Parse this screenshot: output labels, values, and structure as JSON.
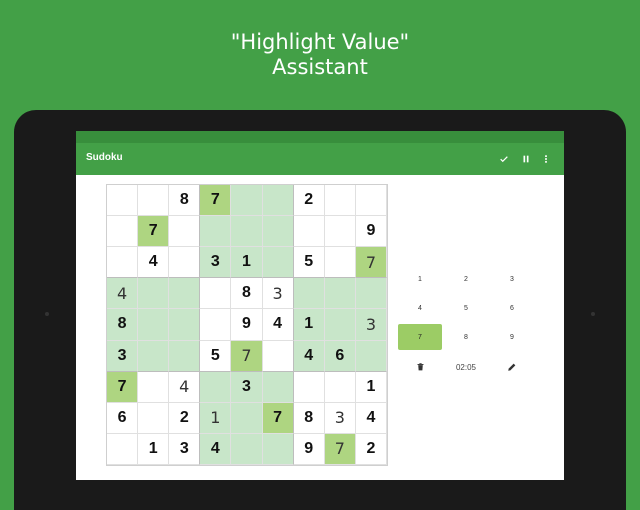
{
  "promo": {
    "line1": "\"Highlight Value\"",
    "line2": "Assistant"
  },
  "app": {
    "title": "Sudoku",
    "icons": [
      "check-icon",
      "pause-icon",
      "more-vert-icon"
    ]
  },
  "colors": {
    "background": "#43a047",
    "statusbar": "#388e3c",
    "highlight": "#c8e6c9",
    "selected": "#aed581",
    "key_active": "#9ccc65"
  },
  "grid": [
    [
      {
        "v": "",
        "t": "",
        "h": 0
      },
      {
        "v": "",
        "t": "",
        "h": 0
      },
      {
        "v": "8",
        "t": "g",
        "h": 0
      },
      {
        "v": "7",
        "t": "g",
        "h": 2
      },
      {
        "v": "",
        "t": "",
        "h": 1
      },
      {
        "v": "",
        "t": "",
        "h": 1
      },
      {
        "v": "2",
        "t": "g",
        "h": 0
      },
      {
        "v": "",
        "t": "",
        "h": 0
      },
      {
        "v": "",
        "t": "",
        "h": 0
      }
    ],
    [
      {
        "v": "",
        "t": "",
        "h": 0
      },
      {
        "v": "7",
        "t": "g",
        "h": 2
      },
      {
        "v": "",
        "t": "",
        "h": 0
      },
      {
        "v": "",
        "t": "",
        "h": 1
      },
      {
        "v": "",
        "t": "",
        "h": 1
      },
      {
        "v": "",
        "t": "",
        "h": 1
      },
      {
        "v": "",
        "t": "",
        "h": 0
      },
      {
        "v": "",
        "t": "",
        "h": 0
      },
      {
        "v": "9",
        "t": "g",
        "h": 0
      }
    ],
    [
      {
        "v": "",
        "t": "",
        "h": 0
      },
      {
        "v": "4",
        "t": "g",
        "h": 0
      },
      {
        "v": "",
        "t": "",
        "h": 0
      },
      {
        "v": "3",
        "t": "g",
        "h": 1
      },
      {
        "v": "1",
        "t": "g",
        "h": 1
      },
      {
        "v": "",
        "t": "",
        "h": 1
      },
      {
        "v": "5",
        "t": "g",
        "h": 0
      },
      {
        "v": "",
        "t": "",
        "h": 0
      },
      {
        "v": "7",
        "t": "e",
        "h": 2
      }
    ],
    [
      {
        "v": "4",
        "t": "e",
        "h": 1
      },
      {
        "v": "",
        "t": "",
        "h": 1
      },
      {
        "v": "",
        "t": "",
        "h": 1
      },
      {
        "v": "",
        "t": "",
        "h": 0
      },
      {
        "v": "8",
        "t": "g",
        "h": 0
      },
      {
        "v": "3",
        "t": "e",
        "h": 0
      },
      {
        "v": "",
        "t": "",
        "h": 1
      },
      {
        "v": "",
        "t": "",
        "h": 1
      },
      {
        "v": "",
        "t": "",
        "h": 1
      }
    ],
    [
      {
        "v": "8",
        "t": "g",
        "h": 1
      },
      {
        "v": "",
        "t": "",
        "h": 1
      },
      {
        "v": "",
        "t": "",
        "h": 1
      },
      {
        "v": "",
        "t": "",
        "h": 0
      },
      {
        "v": "9",
        "t": "g",
        "h": 0
      },
      {
        "v": "4",
        "t": "g",
        "h": 0
      },
      {
        "v": "1",
        "t": "g",
        "h": 1
      },
      {
        "v": "",
        "t": "",
        "h": 1
      },
      {
        "v": "3",
        "t": "e",
        "h": 1
      }
    ],
    [
      {
        "v": "3",
        "t": "g",
        "h": 1
      },
      {
        "v": "",
        "t": "",
        "h": 1
      },
      {
        "v": "",
        "t": "",
        "h": 1
      },
      {
        "v": "5",
        "t": "g",
        "h": 0
      },
      {
        "v": "7",
        "t": "e",
        "h": 2
      },
      {
        "v": "",
        "t": "",
        "h": 0
      },
      {
        "v": "4",
        "t": "g",
        "h": 1
      },
      {
        "v": "6",
        "t": "g",
        "h": 1
      },
      {
        "v": "",
        "t": "",
        "h": 1
      }
    ],
    [
      {
        "v": "7",
        "t": "g",
        "h": 2
      },
      {
        "v": "",
        "t": "",
        "h": 0
      },
      {
        "v": "4",
        "t": "e",
        "h": 0
      },
      {
        "v": "",
        "t": "",
        "h": 1
      },
      {
        "v": "3",
        "t": "g",
        "h": 1
      },
      {
        "v": "",
        "t": "",
        "h": 1
      },
      {
        "v": "",
        "t": "",
        "h": 0
      },
      {
        "v": "",
        "t": "",
        "h": 0
      },
      {
        "v": "1",
        "t": "g",
        "h": 0
      }
    ],
    [
      {
        "v": "6",
        "t": "g",
        "h": 0
      },
      {
        "v": "",
        "t": "",
        "h": 0
      },
      {
        "v": "2",
        "t": "g",
        "h": 0
      },
      {
        "v": "1",
        "t": "e",
        "h": 1
      },
      {
        "v": "",
        "t": "",
        "h": 1
      },
      {
        "v": "7",
        "t": "g",
        "h": 2
      },
      {
        "v": "8",
        "t": "g",
        "h": 0
      },
      {
        "v": "3",
        "t": "e",
        "h": 0
      },
      {
        "v": "4",
        "t": "g",
        "h": 0
      }
    ],
    [
      {
        "v": "",
        "t": "",
        "h": 0
      },
      {
        "v": "1",
        "t": "g",
        "h": 0
      },
      {
        "v": "3",
        "t": "g",
        "h": 0
      },
      {
        "v": "4",
        "t": "g",
        "h": 1
      },
      {
        "v": "",
        "t": "",
        "h": 1
      },
      {
        "v": "",
        "t": "",
        "h": 1
      },
      {
        "v": "9",
        "t": "g",
        "h": 0
      },
      {
        "v": "7",
        "t": "e",
        "h": 2
      },
      {
        "v": "2",
        "t": "g",
        "h": 0
      }
    ]
  ],
  "keypad": {
    "keys": [
      "1",
      "2",
      "3",
      "4",
      "5",
      "6",
      "7",
      "8",
      "9"
    ],
    "active": "7"
  },
  "tools": {
    "erase_icon": "trash-icon",
    "timer": "02:05",
    "pencil_icon": "pencil-icon"
  }
}
